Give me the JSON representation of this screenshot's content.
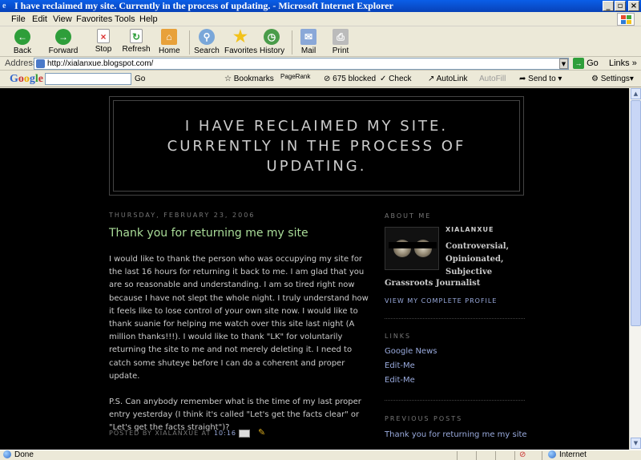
{
  "window": {
    "title": "I have reclaimed my site. Currently in the process of updating. - Microsoft Internet Explorer"
  },
  "menu": [
    "File",
    "Edit",
    "View",
    "Favorites",
    "Tools",
    "Help"
  ],
  "toolbar": {
    "back": "Back",
    "forward": "Forward",
    "stop": "Stop",
    "refresh": "Refresh",
    "home": "Home",
    "search": "Search",
    "favorites": "Favorites",
    "history": "History",
    "mail": "Mail",
    "print": "Print"
  },
  "address": {
    "label": "Address",
    "url": "http://xialanxue.blogspot.com/",
    "go": "Go",
    "links": "Links"
  },
  "google_toolbar": {
    "logo": "Google",
    "go": "Go",
    "bookmarks": "Bookmarks",
    "pagerank": "PageRank",
    "blocked": "675 blocked",
    "check": "Check",
    "autolink": "AutoLink",
    "autofill": "AutoFill",
    "sendto": "Send to",
    "settings": "Settings"
  },
  "blog": {
    "title": "I HAVE RECLAIMED MY SITE. CURRENTLY IN THE PROCESS OF UPDATING.",
    "date": "THURSDAY, FEBRUARY 23, 2006",
    "post_title": "Thank you for returning me my site",
    "paragraphs": [
      "I would like to thank the person who was occupying my site for the last 16 hours for returning it back to me. I am glad that you are so reasonable and understanding. I am so tired right now because I have not slept the whole night. I truly understand how it feels like to lose control of your own site now. I would like to thank suanie for helping me watch over this site last night (A million thanks!!!). I would like to thank \"LK\" for voluntarily returning the site to me and not merely deleting it. I need to catch some shuteye before I can do a coherent and proper update.",
      "P.S. Can anybody remember what is the time of my last proper entry yesterday (I think it's called \"Let's get the facts clear\" or \"Let's get the facts straight\")?"
    ],
    "footer_prefix": "POSTED BY XIALANXUE AT",
    "footer_time": "10:16 AM"
  },
  "sidebar": {
    "about_heading": "ABOUT ME",
    "name": "XIALANXUE",
    "desc": "Controversial, Opinionated, Subjective",
    "desc2": "Grassroots Journalist",
    "view_profile": "VIEW MY COMPLETE PROFILE",
    "links_heading": "LINKS",
    "links": [
      "Google News",
      "Edit-Me",
      "Edit-Me"
    ],
    "previous_heading": "PREVIOUS POSTS",
    "previous": [
      "Thank you for returning me my site"
    ]
  },
  "status": {
    "text": "Done",
    "zone": "Internet"
  }
}
